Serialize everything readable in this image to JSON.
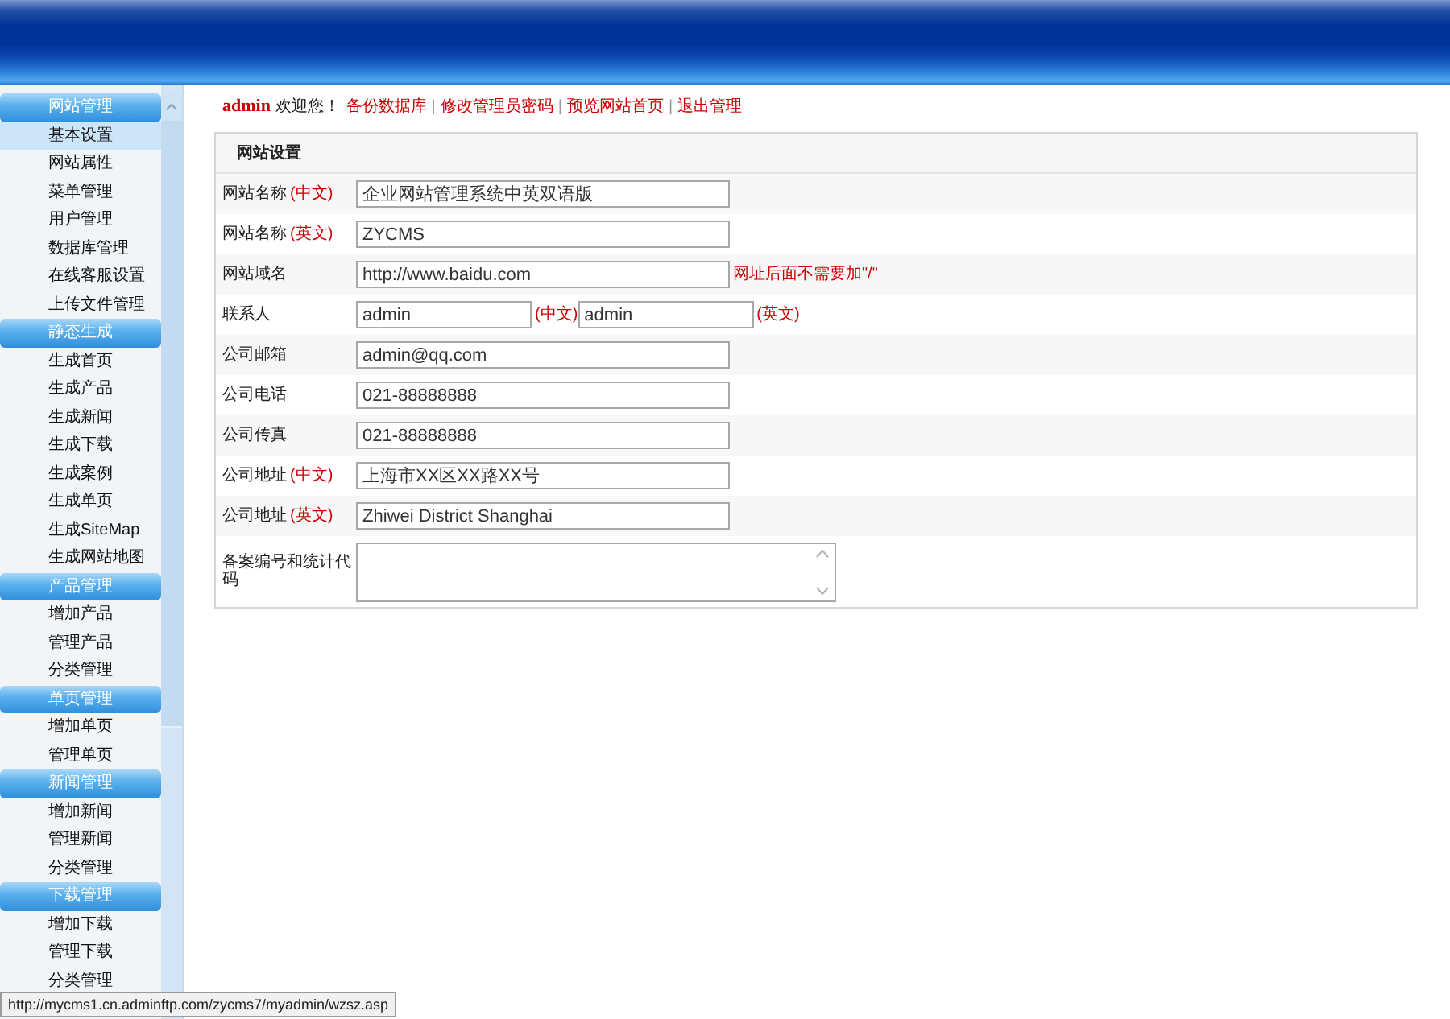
{
  "sidebar": {
    "sections": [
      {
        "title": "网站管理",
        "items": [
          {
            "label": "基本设置",
            "selected": true
          },
          {
            "label": "网站属性",
            "selected": false
          },
          {
            "label": "菜单管理",
            "selected": false
          },
          {
            "label": "用户管理",
            "selected": false
          },
          {
            "label": "数据库管理",
            "selected": false
          },
          {
            "label": "在线客服设置",
            "selected": false
          },
          {
            "label": "上传文件管理",
            "selected": false
          }
        ]
      },
      {
        "title": "静态生成",
        "items": [
          {
            "label": "生成首页",
            "selected": false
          },
          {
            "label": "生成产品",
            "selected": false
          },
          {
            "label": "生成新闻",
            "selected": false
          },
          {
            "label": "生成下载",
            "selected": false
          },
          {
            "label": "生成案例",
            "selected": false
          },
          {
            "label": "生成单页",
            "selected": false
          },
          {
            "label": "生成SiteMap",
            "selected": false
          },
          {
            "label": "生成网站地图",
            "selected": false
          }
        ]
      },
      {
        "title": "产品管理",
        "items": [
          {
            "label": "增加产品",
            "selected": false
          },
          {
            "label": "管理产品",
            "selected": false
          },
          {
            "label": "分类管理",
            "selected": false
          }
        ]
      },
      {
        "title": "单页管理",
        "items": [
          {
            "label": "增加单页",
            "selected": false
          },
          {
            "label": "管理单页",
            "selected": false
          }
        ]
      },
      {
        "title": "新闻管理",
        "items": [
          {
            "label": "增加新闻",
            "selected": false
          },
          {
            "label": "管理新闻",
            "selected": false
          },
          {
            "label": "分类管理",
            "selected": false
          }
        ]
      },
      {
        "title": "下载管理",
        "items": [
          {
            "label": "增加下载",
            "selected": false
          },
          {
            "label": "管理下载",
            "selected": false
          },
          {
            "label": "分类管理",
            "selected": false
          }
        ]
      }
    ]
  },
  "top_bar": {
    "user": "admin",
    "greeting": "欢迎您！",
    "links": [
      {
        "kind": "link",
        "text": "备份数据库"
      },
      {
        "kind": "separator",
        "text": "|"
      },
      {
        "kind": "link",
        "text": "修改管理员密码"
      },
      {
        "kind": "separator",
        "text": "|"
      },
      {
        "kind": "link",
        "text": "预览网站首页"
      },
      {
        "kind": "separator",
        "text": "|"
      },
      {
        "kind": "link",
        "text": "退出管理"
      }
    ]
  },
  "settings": {
    "title": "网站设置",
    "rows": [
      {
        "kind": "text",
        "label": "网站名称",
        "note": "(中文)",
        "value": "企业网站管理系统中英双语版"
      },
      {
        "kind": "text",
        "label": "网站名称",
        "note": "(英文)",
        "value": "ZYCMS"
      },
      {
        "kind": "text",
        "label": "网站域名",
        "value": "http://www.baidu.com",
        "hint": "网址后面不需要加\"/\""
      },
      {
        "kind": "pair",
        "label": "联系人",
        "fields": [
          {
            "value": "admin",
            "note": "(中文)"
          },
          {
            "value": "admin",
            "note": "(英文)"
          }
        ]
      },
      {
        "kind": "text",
        "label": "公司邮箱",
        "value": "admin@qq.com"
      },
      {
        "kind": "text",
        "label": "公司电话",
        "value": "021-88888888"
      },
      {
        "kind": "text",
        "label": "公司传真",
        "value": "021-88888888"
      },
      {
        "kind": "text",
        "label": "公司地址",
        "note": "(中文)",
        "value": "上海市XX区XX路XX号"
      },
      {
        "kind": "text",
        "label": "公司地址",
        "note": "(英文)",
        "value": "Zhiwei District Shanghai"
      },
      {
        "kind": "textarea",
        "label": "备案编号和统计代码"
      }
    ]
  },
  "status_bar": {
    "url": "http://mycms1.cn.adminftp.com/zycms7/myadmin/wzsz.asp"
  }
}
